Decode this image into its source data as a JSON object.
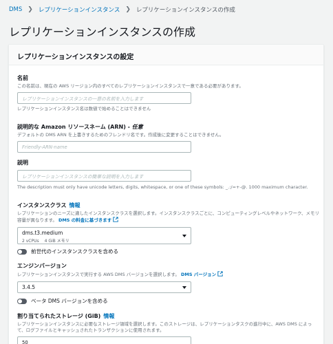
{
  "breadcrumb": {
    "items": [
      "DMS",
      "レプリケーションインスタンス",
      "レプリケーションインスタンスの作成"
    ]
  },
  "page": {
    "title": "レプリケーションインスタンスの作成"
  },
  "panel": {
    "title": "レプリケーションインスタンスの設定",
    "name": {
      "label": "名前",
      "description": "この名前は、現在の AWS リージョン内のすべてのレプリケーションインスタンスで一意である必要があります。",
      "placeholder": "レプリケーションインスタンスの一意の名前を入力します",
      "value": "",
      "constraint": "レプリケーションインスタンス名は数値で始めることはできません"
    },
    "arn": {
      "label": "説明的な Amazon リソースネーム (ARN) - ",
      "optional": "任意",
      "description": "デフォルトの DMS ARN を上書きするためのフレンドリ名です。作成後に変更することはできません。",
      "placeholder": "Friendly-ARN-name",
      "value": ""
    },
    "description_field": {
      "label": "説明",
      "placeholder": "レプリケーションインスタンスの簡単な説明を入力します",
      "value": "",
      "constraint": "The description must only have unicode letters, digits, whitespace, or one of these symbols: _.:/=+-@. 1000 maximum character."
    },
    "instance_class": {
      "label": "インスタンスクラス",
      "info": "情報",
      "description": "レプリケーションのニーズに適したインスタンスクラスを選択します。インスタンスクラスごとに、コンピューティングレベルやネットワーク、メモリ容量が異なります。",
      "link": "DMS の料金に基づきます",
      "selected": "dms.t3.medium",
      "specs": [
        "2 vCPUs",
        "4 GiB メモリ"
      ]
    },
    "next_gen_toggle": {
      "label": "前世代のインスタンスクラスを含める",
      "on": false
    },
    "engine_version": {
      "label": "エンジンバージョン",
      "description": "レプリケーションインスタンスで実行する AWS DMS バージョンを選択します。",
      "link": "DMS バージョン",
      "selected": "3.4.5"
    },
    "beta_toggle": {
      "label": "ベータ DMS バージョンを含める",
      "on": false
    },
    "storage": {
      "label": "割り当てられたストレージ (GiB)",
      "info": "情報",
      "description": "レプリケーションインスタンスに必要なストレージ領域を選択します。このストレージは、レプリケーションタスクの進行中に、AWS DMS によって、ログファイルとキャッシュされたトランザクションに使用されます。",
      "value": "50"
    }
  },
  "colors": {
    "link": "#0073bb",
    "background": "#f2f3f3",
    "toggle_off": "#545b64"
  }
}
